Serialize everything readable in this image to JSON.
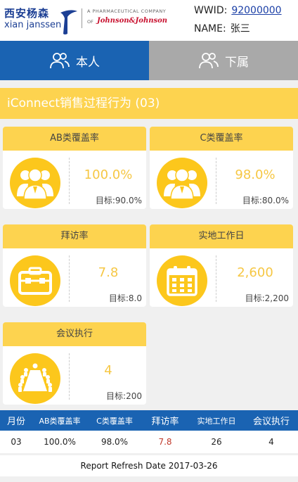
{
  "header": {
    "logo_cn": "西安杨森",
    "logo_en": "xian janssen",
    "pharma_line": "A PHARMACEUTICAL COMPANY",
    "pharma_of": "OF",
    "pharma_parent": "Johnson&Johnson",
    "wwid_label": "WWID:",
    "wwid_value": "92000000",
    "name_label": "NAME:",
    "name_value": "张三"
  },
  "tabs": [
    {
      "label": "本人",
      "active": true,
      "icon": "person-icon"
    },
    {
      "label": "下属",
      "active": false,
      "icon": "group-icon"
    }
  ],
  "section": {
    "title": "iConnect销售过程行为 (03)"
  },
  "cards": [
    {
      "title": "AB类覆盖率",
      "value": "100.0%",
      "target": "目标:90.0%",
      "icon": "team-icon"
    },
    {
      "title": "C类覆盖率",
      "value": "98.0%",
      "target": "目标:80.0%",
      "icon": "team-icon"
    },
    {
      "title": "拜访率",
      "value": "7.8",
      "target": "目标:8.0",
      "icon": "briefcase-icon"
    },
    {
      "title": "实地工作日",
      "value": "2,600",
      "target": "目标:2,200",
      "icon": "calendar-icon"
    },
    {
      "title": "会议执行",
      "value": "4",
      "target": "目标:200",
      "icon": "meeting-icon"
    }
  ],
  "table": {
    "headers": [
      "月份",
      "AB类覆盖率",
      "C类覆盖率",
      "拜访率",
      "实地工作日",
      "会议执行"
    ],
    "row": [
      "03",
      "100.0%",
      "98.0%",
      "7.8",
      "26",
      "4"
    ]
  },
  "footer": {
    "refresh": "Report Refresh Date 2017-03-26"
  },
  "colors": {
    "brand_blue": "#1a63b2",
    "accent_yellow": "#fdd34f",
    "value_yellow": "#f6c744",
    "icon_yellow": "#fcc71c",
    "tab_inactive": "#a9a9a9",
    "alert_red": "#c0392b"
  }
}
